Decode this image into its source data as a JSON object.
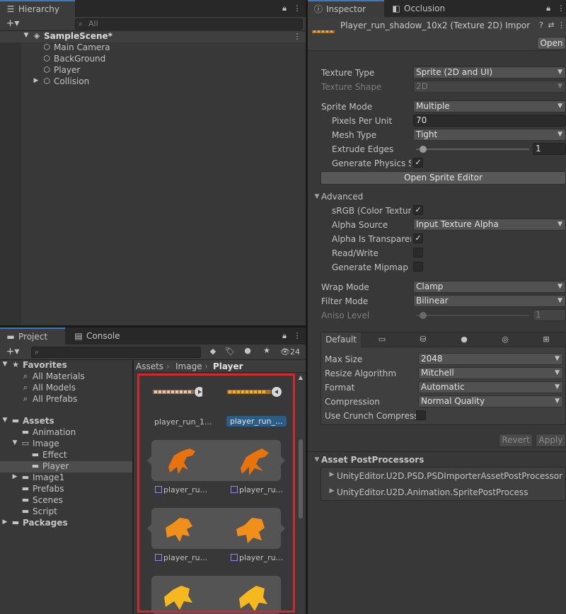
{
  "hierarchy": {
    "tab_label": "Hierarchy",
    "search_placeholder": "All",
    "scene_name": "SampleScene*",
    "items": [
      {
        "label": "Main Camera"
      },
      {
        "label": "BackGround"
      },
      {
        "label": "Player"
      },
      {
        "label": "Collision"
      }
    ]
  },
  "project": {
    "tab_label": "Project",
    "console_tab_label": "Console",
    "hidden_count": "24",
    "tree": {
      "favorites": "Favorites",
      "fav_items": [
        "All Materials",
        "All Models",
        "All Prefabs"
      ],
      "assets": "Assets",
      "animation": "Animation",
      "image": "Image",
      "effect": "Effect",
      "player": "Player",
      "image1": "Image1",
      "prefabs": "Prefabs",
      "scenes": "Scenes",
      "script": "Script",
      "packages": "Packages"
    },
    "breadcrumb": [
      "Assets",
      "Image",
      "Player"
    ],
    "files": {
      "row1_a": "player_run_1...",
      "row1_b": "player_run_...",
      "row2_a": "player_ru...",
      "row2_b": "player_ru...",
      "row3_a": "player_ru...",
      "row3_b": "player_ru..."
    }
  },
  "inspector": {
    "tab_label": "Inspector",
    "occlusion_tab_label": "Occlusion",
    "asset_title": "Player_run_shadow_10x2 (Texture 2D) Impor",
    "open_button": "Open",
    "texture_type_label": "Texture Type",
    "texture_type_value": "Sprite (2D and UI)",
    "texture_shape_label": "Texture Shape",
    "texture_shape_value": "2D",
    "sprite_mode_label": "Sprite Mode",
    "sprite_mode_value": "Multiple",
    "ppu_label": "Pixels Per Unit",
    "ppu_value": "70",
    "mesh_type_label": "Mesh Type",
    "mesh_type_value": "Tight",
    "extrude_label": "Extrude Edges",
    "extrude_value": "1",
    "extrude_fraction": 0.03,
    "physics_label": "Generate Physics Sl",
    "open_sprite_editor": "Open Sprite Editor",
    "advanced_label": "Advanced",
    "srgb_label": "sRGB (Color Texture",
    "alpha_source_label": "Alpha Source",
    "alpha_source_value": "Input Texture Alpha",
    "alpha_transparent_label": "Alpha Is Transparen",
    "readwrite_label": "Read/Write",
    "mipmap_label": "Generate Mipmap",
    "wrap_label": "Wrap Mode",
    "wrap_value": "Clamp",
    "filter_label": "Filter Mode",
    "filter_value": "Bilinear",
    "aniso_label": "Aniso Level",
    "aniso_value": "1",
    "platform_default": "Default",
    "max_size_label": "Max Size",
    "max_size_value": "2048",
    "resize_label": "Resize Algorithm",
    "resize_value": "Mitchell",
    "format_label": "Format",
    "format_value": "Automatic",
    "compression_label": "Compression",
    "compression_value": "Normal Quality",
    "crunch_label": "Use Crunch Compress",
    "revert_button": "Revert",
    "apply_button": "Apply",
    "postprocessors_label": "Asset PostProcessors",
    "pp_items": [
      "UnityEditor.U2D.PSD.PSDImporterAssetPostProcessor",
      "UnityEditor.U2D.Animation.SpritePostProcess"
    ]
  },
  "colors": {
    "accent": "#3a79bb",
    "highlight_box": "#d0282e",
    "selection": "#4d4d4d"
  }
}
